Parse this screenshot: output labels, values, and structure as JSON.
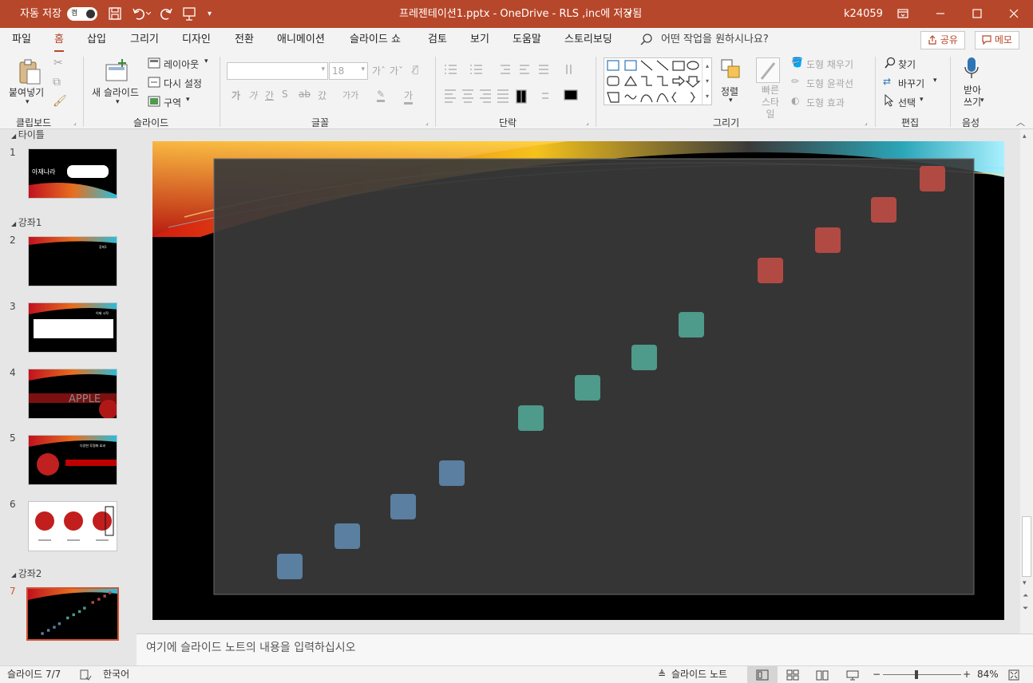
{
  "titlebar": {
    "autosave_label": "자동 저장",
    "autosave_state": "켬",
    "doc_title": "프레젠테이션1.pptx  -  OneDrive - RLS ,inc에 저장됨",
    "user": "k24059",
    "accent_color": "#b7472a"
  },
  "menu": {
    "tabs": [
      "파일",
      "홈",
      "삽입",
      "그리기",
      "디자인",
      "전환",
      "애니메이션",
      "슬라이드 쇼",
      "검토",
      "보기",
      "도움말",
      "스토리보딩"
    ],
    "active": "홈",
    "search_placeholder": "어떤 작업을 원하시나요?",
    "share": "공유",
    "comments": "메모"
  },
  "ribbon": {
    "clipboard": {
      "paste": "붙여넣기",
      "label": "클립보드"
    },
    "slides": {
      "new_slide": "새 슬라이드",
      "layout": "레이아웃",
      "reset": "다시 설정",
      "section": "구역",
      "label": "슬라이드"
    },
    "font": {
      "font_name": "",
      "font_size": "18",
      "label": "글꼴"
    },
    "paragraph": {
      "label": "단락"
    },
    "drawing": {
      "arrange": "정렬",
      "quick_styles": "빠른 스타일",
      "fill": "도형 채우기",
      "outline": "도형 윤곽선",
      "effects": "도형 효과",
      "label": "그리기"
    },
    "editing": {
      "find": "찾기",
      "replace": "바꾸기",
      "select": "선택",
      "label": "편집"
    },
    "voice": {
      "dictate": "받아 쓰기",
      "label": "음성"
    }
  },
  "thumbnails": {
    "sections": [
      "타이틀",
      "강좌1",
      "강좌2"
    ],
    "slides": [
      {
        "num": "1",
        "text": "아재나라"
      },
      {
        "num": "2",
        "text": "강좌1"
      },
      {
        "num": "3",
        "text": "이제 시작"
      },
      {
        "num": "4",
        "text": "APPLE"
      },
      {
        "num": "5",
        "text": "다양한 투명화 효과"
      },
      {
        "num": "6",
        "text": ""
      },
      {
        "num": "7",
        "text": ""
      }
    ],
    "selected": "7"
  },
  "slide": {
    "squares": [
      {
        "color": "#5a7fa0"
      },
      {
        "color": "#5a7fa0"
      },
      {
        "color": "#5a7fa0"
      },
      {
        "color": "#5a7fa0"
      },
      {
        "color": "#4e9a8b"
      },
      {
        "color": "#4e9a8b"
      },
      {
        "color": "#4e9a8b"
      },
      {
        "color": "#4e9a8b"
      },
      {
        "color": "#b24a44"
      },
      {
        "color": "#b24a44"
      },
      {
        "color": "#b24a44"
      },
      {
        "color": "#b24a44"
      }
    ],
    "panel_color": "#3a3a3a"
  },
  "notes": {
    "placeholder": "여기에 슬라이드 노트의 내용을 입력하십시오"
  },
  "status": {
    "slide_info": "슬라이드 7/7",
    "language": "한국어",
    "notes_button": "슬라이드 노트",
    "zoom": "84%"
  }
}
